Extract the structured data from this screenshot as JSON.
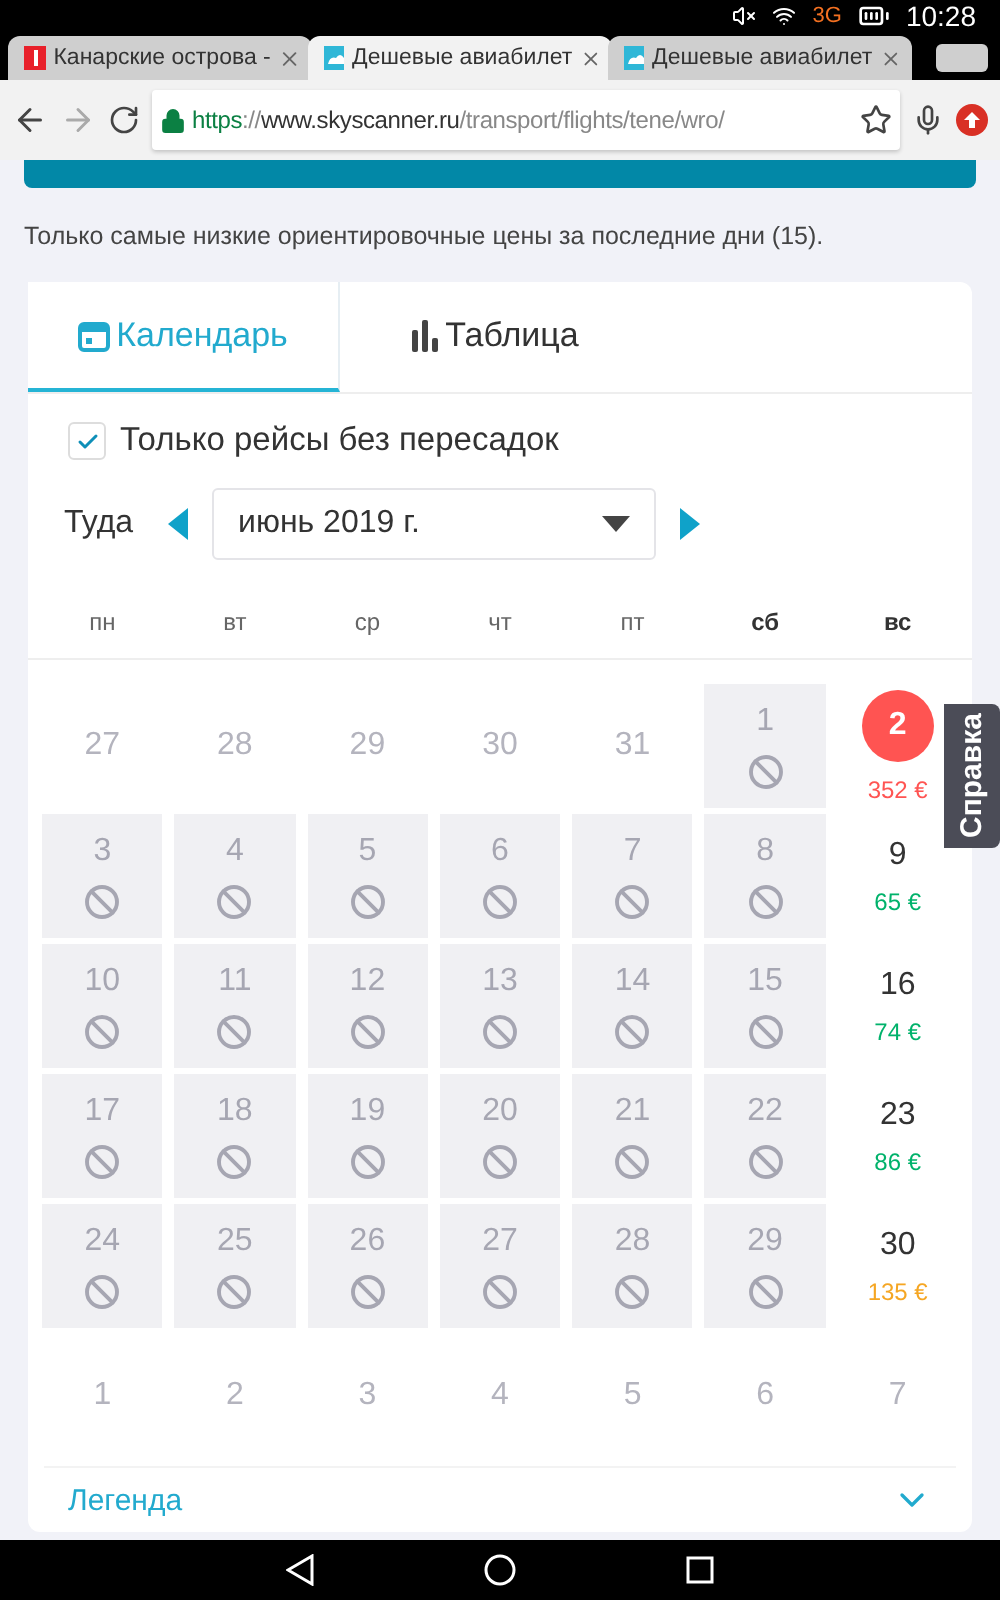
{
  "status_bar": {
    "network": "3G",
    "time": "10:28"
  },
  "browser_tabs": [
    {
      "title": "Канарские острова -",
      "selected": false
    },
    {
      "title": "Дешевые авиабилет",
      "selected": true
    },
    {
      "title": "Дешевые авиабилет",
      "selected": false
    }
  ],
  "address_bar": {
    "scheme": "https",
    "separator": "://",
    "host": "www.skyscanner.ru",
    "path": "/transport/flights/tene/wro/"
  },
  "note": "Только самые низкие ориентировочные цены за последние дни (15).",
  "view_tabs": [
    {
      "label": "Календарь",
      "selected": true
    },
    {
      "label": "Таблица",
      "selected": false
    }
  ],
  "direct_only": {
    "label": "Только рейсы без пересадок",
    "checked": true
  },
  "month_picker": {
    "label": "Туда",
    "month": "июнь 2019 г."
  },
  "weekdays": [
    {
      "label": "пн",
      "weekend": false
    },
    {
      "label": "вт",
      "weekend": false
    },
    {
      "label": "ср",
      "weekend": false
    },
    {
      "label": "чт",
      "weekend": false
    },
    {
      "label": "пт",
      "weekend": false
    },
    {
      "label": "сб",
      "weekend": true
    },
    {
      "label": "вс",
      "weekend": true
    }
  ],
  "weeks": [
    [
      {
        "day": "27",
        "kind": "outside"
      },
      {
        "day": "28",
        "kind": "outside"
      },
      {
        "day": "29",
        "kind": "outside"
      },
      {
        "day": "30",
        "kind": "outside"
      },
      {
        "day": "31",
        "kind": "outside"
      },
      {
        "day": "1",
        "kind": "unavailable"
      },
      {
        "day": "2",
        "kind": "price",
        "price": "352 €",
        "color": "#ff5452",
        "selected": true
      }
    ],
    [
      {
        "day": "3",
        "kind": "unavailable"
      },
      {
        "day": "4",
        "kind": "unavailable"
      },
      {
        "day": "5",
        "kind": "unavailable"
      },
      {
        "day": "6",
        "kind": "unavailable"
      },
      {
        "day": "7",
        "kind": "unavailable"
      },
      {
        "day": "8",
        "kind": "unavailable"
      },
      {
        "day": "9",
        "kind": "price",
        "price": "65 €",
        "color": "#00b26b",
        "selected": false
      }
    ],
    [
      {
        "day": "10",
        "kind": "unavailable"
      },
      {
        "day": "11",
        "kind": "unavailable"
      },
      {
        "day": "12",
        "kind": "unavailable"
      },
      {
        "day": "13",
        "kind": "unavailable"
      },
      {
        "day": "14",
        "kind": "unavailable"
      },
      {
        "day": "15",
        "kind": "unavailable"
      },
      {
        "day": "16",
        "kind": "price",
        "price": "74 €",
        "color": "#00b26b",
        "selected": false
      }
    ],
    [
      {
        "day": "17",
        "kind": "unavailable"
      },
      {
        "day": "18",
        "kind": "unavailable"
      },
      {
        "day": "19",
        "kind": "unavailable"
      },
      {
        "day": "20",
        "kind": "unavailable"
      },
      {
        "day": "21",
        "kind": "unavailable"
      },
      {
        "day": "22",
        "kind": "unavailable"
      },
      {
        "day": "23",
        "kind": "price",
        "price": "86 €",
        "color": "#00b26b",
        "selected": false
      }
    ],
    [
      {
        "day": "24",
        "kind": "unavailable"
      },
      {
        "day": "25",
        "kind": "unavailable"
      },
      {
        "day": "26",
        "kind": "unavailable"
      },
      {
        "day": "27",
        "kind": "unavailable"
      },
      {
        "day": "28",
        "kind": "unavailable"
      },
      {
        "day": "29",
        "kind": "unavailable"
      },
      {
        "day": "30",
        "kind": "price",
        "price": "135 €",
        "color": "#f5a623",
        "selected": false
      }
    ],
    [
      {
        "day": "1",
        "kind": "outside"
      },
      {
        "day": "2",
        "kind": "outside"
      },
      {
        "day": "3",
        "kind": "outside"
      },
      {
        "day": "4",
        "kind": "outside"
      },
      {
        "day": "5",
        "kind": "outside"
      },
      {
        "day": "6",
        "kind": "outside"
      },
      {
        "day": "7",
        "kind": "outside"
      }
    ]
  ],
  "legend": {
    "label": "Легенда",
    "expanded": false
  },
  "help_tab": "Справка"
}
